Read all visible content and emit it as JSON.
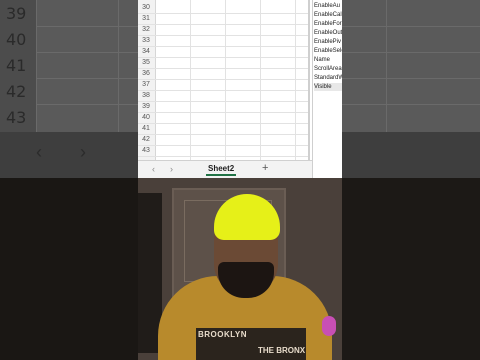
{
  "background_rows": [
    "39",
    "40",
    "41",
    "42",
    "43"
  ],
  "spreadsheet": {
    "row_numbers": [
      "30",
      "31",
      "32",
      "33",
      "34",
      "35",
      "36",
      "37",
      "38",
      "39",
      "40",
      "41",
      "42",
      "43"
    ],
    "properties": [
      "EnableAu",
      "EnableCal",
      "EnableFor",
      "EnableOut",
      "EnablePiv",
      "EnableSele",
      "Name",
      "ScrollArea",
      "StandardW",
      "Visible"
    ],
    "selected_property": "Visible",
    "sheet_tab": "Sheet2",
    "add_sheet": "+",
    "nav_prev": "‹",
    "nav_next": "›"
  },
  "video": {
    "shirt_line1": "BROOKLYN",
    "shirt_line2": "THE BRONX"
  },
  "colors": {
    "accent": "#217346",
    "cap": "#e6f018"
  }
}
